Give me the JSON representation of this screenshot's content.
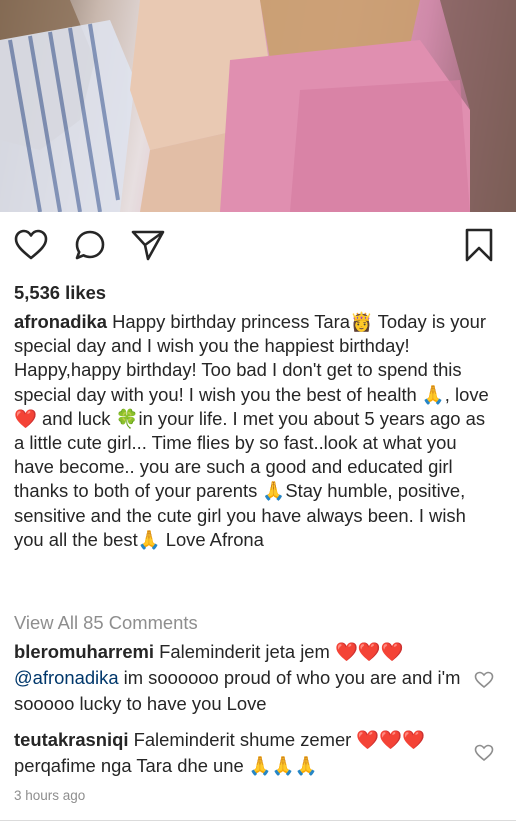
{
  "post": {
    "likes": "5,536 likes",
    "author": "afronadika",
    "caption": "Happy birthday princess Tara👸 Today is your special day and I wish you the happiest birthday! Happy,happy birthday! Too bad I don't get to spend this special day with you! I wish you the best of health 🙏, love❤️ and luck 🍀in your life. I met you about 5 years ago as a little cute girl... Time flies by so fast..look at what you have become.. you are such a good and educated girl thanks to both of your parents 🙏Stay humble, positive, sensitive and the cute girl you have always been. I wish you all the best🙏 Love Afrona",
    "view_all": "View All 85 Comments",
    "timestamp": "3 hours ago"
  },
  "comments": [
    {
      "user": "bleromuharremi",
      "text": "Faleminderit jeta jem ❤️❤️❤️",
      "mention": "@afronadika",
      "text2": " im soooooo proud of who you are and i'm sooooo lucky to have you Love"
    },
    {
      "user": "teutakrasniqi",
      "text": "Faleminderit shume zemer ❤️❤️❤️ perqafime nga Tara dhe une 🙏🙏🙏"
    }
  ],
  "icons": {
    "like": "heart-icon",
    "comment": "comment-icon",
    "share": "send-icon",
    "save": "bookmark-icon",
    "comment_like": "heart-icon"
  },
  "colors": {
    "text": "#262626",
    "muted": "#8e8e8e",
    "mention": "#00376b"
  }
}
